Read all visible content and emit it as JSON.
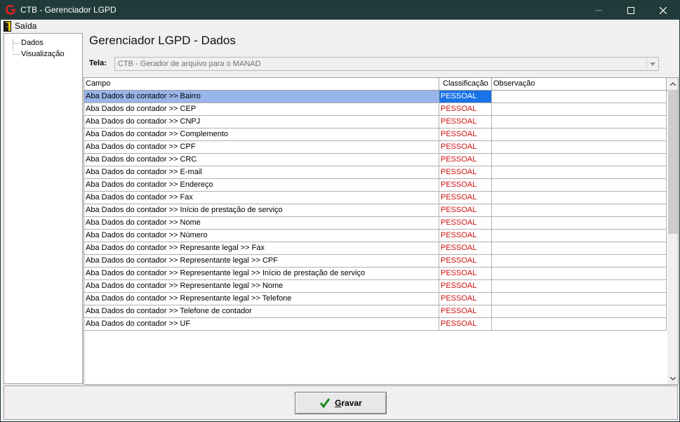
{
  "window": {
    "title": "CTB - Gerenciador LGPD",
    "minimize": "—",
    "maximize": "☐",
    "close": "✕"
  },
  "menu": {
    "exit_label": "Saída"
  },
  "tree": {
    "items": [
      {
        "label": "Dados"
      },
      {
        "label": "Visualização"
      }
    ]
  },
  "main": {
    "title": "Gerenciador LGPD - Dados",
    "tela_label": "Tela:",
    "tela_value": "CTB - Gerador de arquivo para o MANAD"
  },
  "grid": {
    "columns": [
      "Campo",
      "Classificação",
      "Observação"
    ],
    "rows": [
      {
        "campo": "Aba Dados do contador >> Bairro",
        "classificacao": "PESSOAL",
        "observacao": "",
        "selected": true
      },
      {
        "campo": "Aba Dados do contador >> CEP",
        "classificacao": "PESSOAL",
        "observacao": ""
      },
      {
        "campo": "Aba Dados do contador >> CNPJ",
        "classificacao": "PESSOAL",
        "observacao": ""
      },
      {
        "campo": "Aba Dados do contador >> Complemento",
        "classificacao": "PESSOAL",
        "observacao": ""
      },
      {
        "campo": "Aba Dados do contador >> CPF",
        "classificacao": "PESSOAL",
        "observacao": ""
      },
      {
        "campo": "Aba Dados do contador >> CRC",
        "classificacao": "PESSOAL",
        "observacao": ""
      },
      {
        "campo": "Aba Dados do contador >> E-mail",
        "classificacao": "PESSOAL",
        "observacao": ""
      },
      {
        "campo": "Aba Dados do contador >> Endereço",
        "classificacao": "PESSOAL",
        "observacao": ""
      },
      {
        "campo": "Aba Dados do contador >> Fax",
        "classificacao": "PESSOAL",
        "observacao": ""
      },
      {
        "campo": "Aba Dados do contador >> Início de prestação de serviço",
        "classificacao": "PESSOAL",
        "observacao": ""
      },
      {
        "campo": "Aba Dados do contador >> Nome",
        "classificacao": "PESSOAL",
        "observacao": ""
      },
      {
        "campo": "Aba Dados do contador >> Número",
        "classificacao": "PESSOAL",
        "observacao": ""
      },
      {
        "campo": "Aba Dados do contador >> Represante legal >> Fax",
        "classificacao": "PESSOAL",
        "observacao": ""
      },
      {
        "campo": "Aba Dados do contador >> Representante legal >> CPF",
        "classificacao": "PESSOAL",
        "observacao": ""
      },
      {
        "campo": "Aba Dados do contador >> Representante legal >> Início de prestação de serviço",
        "classificacao": "PESSOAL",
        "observacao": ""
      },
      {
        "campo": "Aba Dados do contador >> Representante legal >> Nome",
        "classificacao": "PESSOAL",
        "observacao": ""
      },
      {
        "campo": "Aba Dados do contador >> Representante legal >> Telefone",
        "classificacao": "PESSOAL",
        "observacao": ""
      },
      {
        "campo": "Aba Dados do contador >> Telefone de contador",
        "classificacao": "PESSOAL",
        "observacao": ""
      },
      {
        "campo": "Aba Dados do contador >> UF",
        "classificacao": "PESSOAL",
        "observacao": ""
      }
    ]
  },
  "footer": {
    "save_label": "Gravar"
  },
  "colors": {
    "titlebar": "#213b3b",
    "classification_text": "#d01010",
    "selected_row": "#99b4e8",
    "selected_cell": "#1a73e8"
  },
  "icons": {
    "app": "app-logo-icon",
    "exit": "exit-door-icon",
    "save": "check-icon",
    "dropdown": "chevron-down-icon"
  }
}
